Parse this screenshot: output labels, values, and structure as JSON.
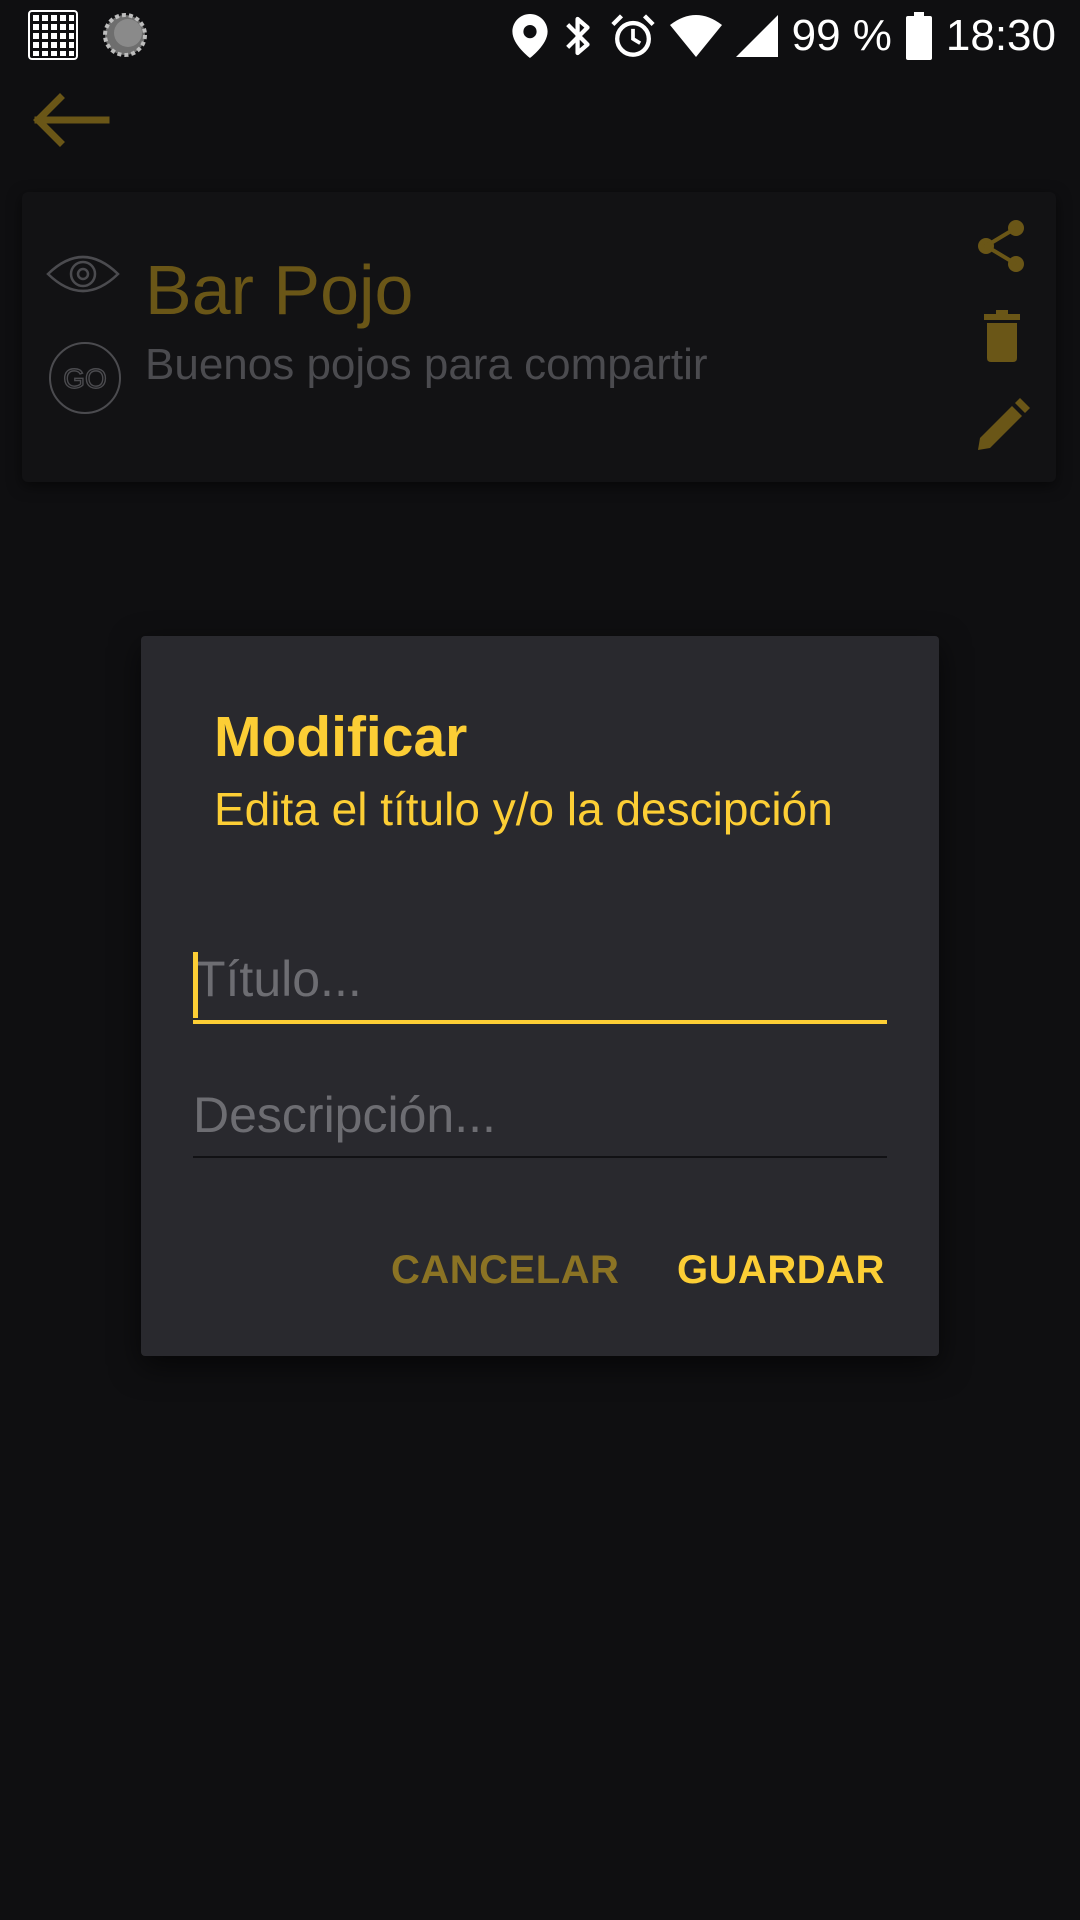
{
  "status_bar": {
    "battery_text": "99 %",
    "time": "18:30",
    "icons": [
      "grid-app-icon",
      "loading-circle-icon",
      "location-icon",
      "bluetooth-icon",
      "alarm-icon",
      "wifi-icon",
      "cell-signal-icon",
      "battery-icon"
    ]
  },
  "top_bar": {
    "back_icon": "arrow-left-icon"
  },
  "card": {
    "title": "Bar Pojo",
    "description": "Buenos pojos para compartir",
    "go_label": "GO",
    "actions": [
      "share-icon",
      "trash-icon",
      "pencil-icon"
    ]
  },
  "dialog": {
    "title": "Modificar",
    "subtitle": "Edita el título y/o la descipción",
    "title_field": {
      "value": "",
      "placeholder": "Título..."
    },
    "description_field": {
      "value": "",
      "placeholder": "Descripción..."
    },
    "cancel_label": "CANCELAR",
    "save_label": "GUARDAR"
  },
  "colors": {
    "background": "#0f0f11",
    "dialog": "#29292e",
    "accent": "#fcce35",
    "accent_dim": "#8b7324"
  }
}
